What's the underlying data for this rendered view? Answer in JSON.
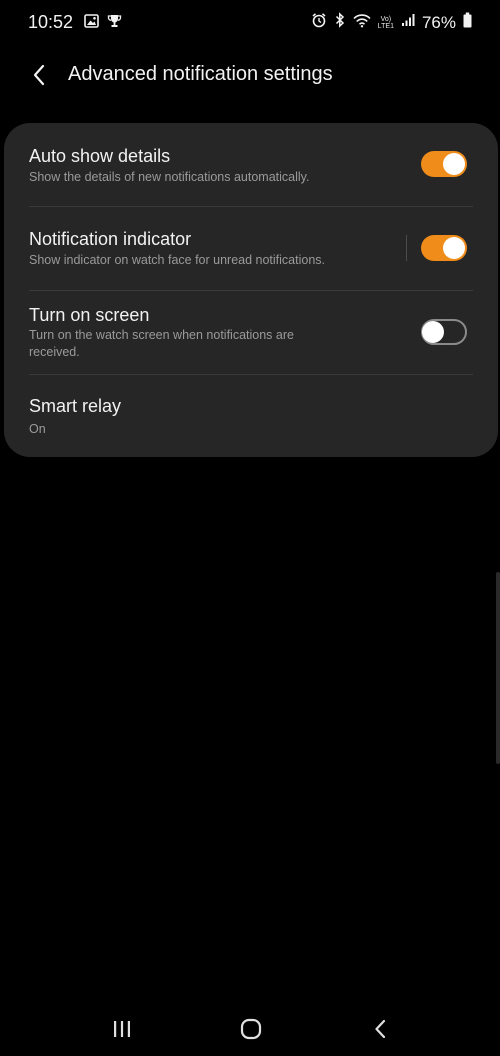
{
  "status_bar": {
    "time": "10:52",
    "battery_percent": "76%",
    "network_label_top": "Vo)",
    "network_label_bottom": "LTE1"
  },
  "header": {
    "title": "Advanced notification settings"
  },
  "settings": [
    {
      "title": "Auto show details",
      "description_lines": [
        "Show the details of new notifications automatically."
      ],
      "toggle": "on"
    },
    {
      "title": "Notification indicator",
      "description_lines": [
        "Show indicator on watch face for unread notifications."
      ],
      "toggle": "on"
    },
    {
      "title": "Turn on screen",
      "description_lines": [
        "Turn on the watch screen when notifications are",
        "received."
      ],
      "toggle": "off"
    },
    {
      "title": "Smart relay",
      "description_lines": [
        "On"
      ]
    }
  ],
  "colors": {
    "background": "#000000",
    "card": "#262626",
    "accent": "#f08c1a",
    "secondary_text": "#9a9a9a"
  },
  "icons": {
    "status_left": [
      "gallery-icon",
      "trophy-icon"
    ],
    "status_right": [
      "alarm-icon",
      "bluetooth-icon",
      "wifi-icon",
      "signal-icon",
      "battery-icon"
    ],
    "nav": [
      "recent-apps-icon",
      "home-icon",
      "back-icon"
    ]
  }
}
